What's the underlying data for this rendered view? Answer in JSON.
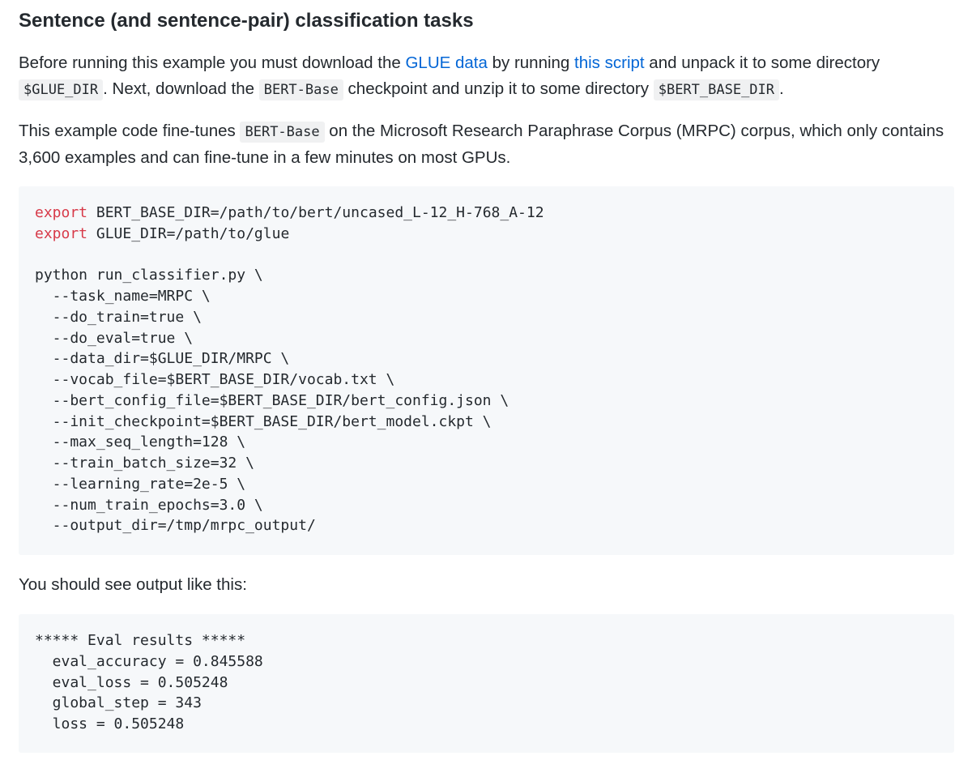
{
  "section": {
    "title": "Sentence (and sentence-pair) classification tasks"
  },
  "para1": {
    "t1": "Before running this example you must download the ",
    "link1": "GLUE data",
    "t2": " by running ",
    "link2": "this script",
    "t3": " and unpack it to some directory ",
    "code1": "$GLUE_DIR",
    "t4": ". Next, download the ",
    "code2": "BERT-Base",
    "t5": " checkpoint and unzip it to some directory ",
    "code3": "$BERT_BASE_DIR",
    "t6": "."
  },
  "para2": {
    "t1": "This example code fine-tunes ",
    "code1": "BERT-Base",
    "t2": " on the Microsoft Research Paraphrase Corpus (MRPC) corpus, which only contains 3,600 examples and can fine-tune in a few minutes on most GPUs."
  },
  "code_block_1": {
    "export_keyword": "export",
    "line1_rest": " BERT_BASE_DIR=/path/to/bert/uncased_L-12_H-768_A-12",
    "line2_rest": " GLUE_DIR=/path/to/glue",
    "lines": [
      "python run_classifier.py \\",
      "  --task_name=MRPC \\",
      "  --do_train=true \\",
      "  --do_eval=true \\",
      "  --data_dir=$GLUE_DIR/MRPC \\",
      "  --vocab_file=$BERT_BASE_DIR/vocab.txt \\",
      "  --bert_config_file=$BERT_BASE_DIR/bert_config.json \\",
      "  --init_checkpoint=$BERT_BASE_DIR/bert_model.ckpt \\",
      "  --max_seq_length=128 \\",
      "  --train_batch_size=32 \\",
      "  --learning_rate=2e-5 \\",
      "  --num_train_epochs=3.0 \\",
      "  --output_dir=/tmp/mrpc_output/"
    ]
  },
  "para3": {
    "text": "You should see output like this:"
  },
  "code_block_2": {
    "lines": [
      "***** Eval results *****",
      "  eval_accuracy = 0.845588",
      "  eval_loss = 0.505248",
      "  global_step = 343",
      "  loss = 0.505248"
    ]
  },
  "colors": {
    "link": "#0366d6",
    "keyword": "#d73a49",
    "code_bg": "#f6f8fa",
    "text": "#24292e"
  }
}
